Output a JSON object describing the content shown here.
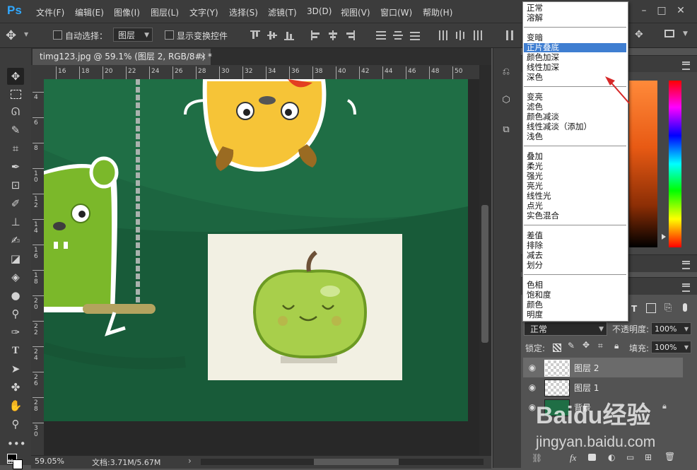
{
  "app": {
    "logo": "Ps",
    "accent": "#31a8ff"
  },
  "menubar": {
    "items": [
      "文件(F)",
      "编辑(E)",
      "图像(I)",
      "图层(L)",
      "文字(Y)",
      "选择(S)",
      "滤镜(T)",
      "3D(D)",
      "视图(V)",
      "窗口(W)",
      "帮助(H)"
    ],
    "window_buttons": [
      "–",
      "□",
      "✕"
    ]
  },
  "options": {
    "auto_select_label": "自动选择：",
    "auto_select_value": "图层",
    "show_transform_label": "显示变换控件",
    "move_icon": "move-icon"
  },
  "document": {
    "tab_title": "timg123.jpg @ 59.1% (图层 2, RGB/8#) *",
    "close": "×"
  },
  "rulers": {
    "h_ticks": [
      "16",
      "18",
      "20",
      "22",
      "24",
      "26",
      "28",
      "30",
      "32",
      "34",
      "36",
      "38",
      "40",
      "42",
      "44",
      "46",
      "48",
      "50"
    ],
    "v_ticks": [
      "4",
      "6",
      "8",
      "1\n0",
      "1\n2",
      "1\n4",
      "1\n6",
      "1\n8",
      "2\n0",
      "2\n2",
      "2\n4",
      "2\n6",
      "2\n8",
      "3\n0"
    ]
  },
  "status": {
    "zoom": "59.05%",
    "doc_info": "文档:3.71M/5.67M",
    "arrow": "›"
  },
  "blend_menu": {
    "groups": [
      [
        "正常",
        "溶解"
      ],
      [
        "变暗",
        "正片叠底",
        "颜色加深",
        "线性加深",
        "深色"
      ],
      [
        "变亮",
        "滤色",
        "颜色减淡",
        "线性减淡（添加）",
        "浅色"
      ],
      [
        "叠加",
        "柔光",
        "强光",
        "亮光",
        "线性光",
        "点光",
        "实色混合"
      ],
      [
        "差值",
        "排除",
        "减去",
        "划分"
      ],
      [
        "色相",
        "饱和度",
        "颜色",
        "明度"
      ]
    ],
    "highlighted": "正片叠底"
  },
  "layers_panel": {
    "blend_mode": "正常",
    "opacity_label": "不透明度:",
    "opacity_value": "100%",
    "lock_label": "锁定:",
    "fill_label": "填充:",
    "fill_value": "100%",
    "layers": [
      {
        "name": "图层 2",
        "selected": true
      },
      {
        "name": "图层 1",
        "selected": false
      },
      {
        "name": "背景",
        "selected": false
      }
    ],
    "footer_icons": [
      "link-icon",
      "fx-icon",
      "mask-icon",
      "adjustment-icon",
      "folder-icon",
      "new-layer-icon",
      "trash-icon"
    ],
    "fx_label": "fx"
  },
  "watermark": {
    "brand": "Baidu经验",
    "url": "jingyan.baidu.com"
  },
  "colors": {
    "canvas_green": "#1f6e45",
    "highlight": "#3f7ed1",
    "arrow": "#d62828"
  }
}
